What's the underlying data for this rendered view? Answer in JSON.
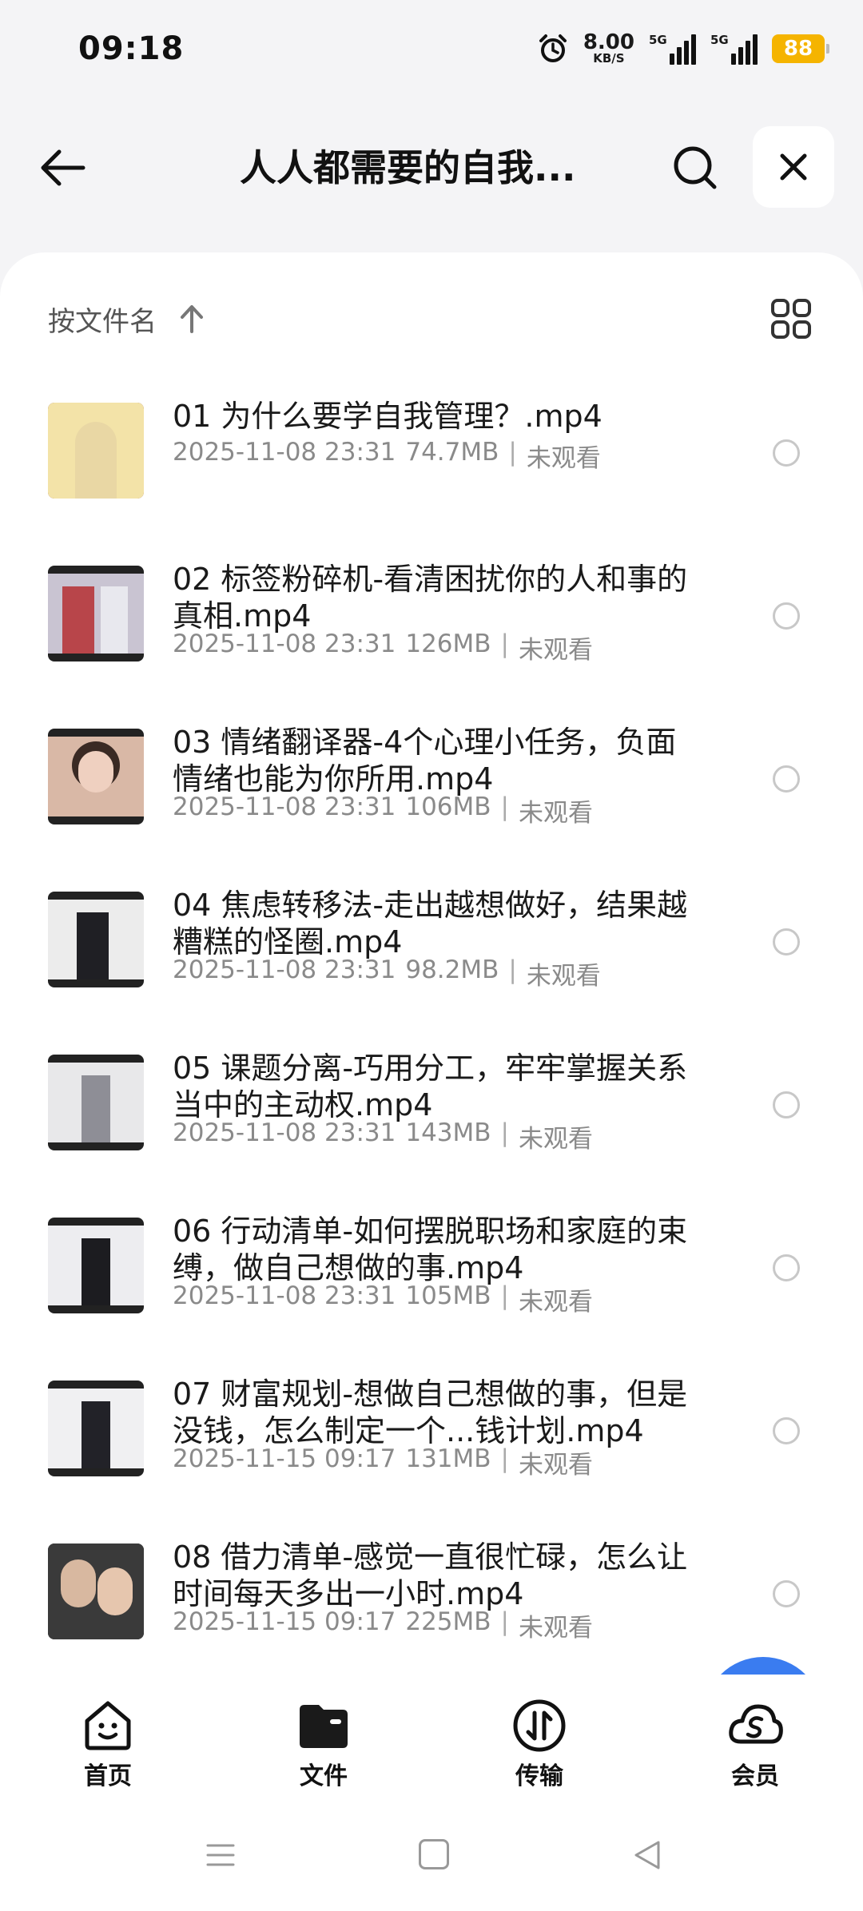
{
  "status_bar": {
    "time": "09:18",
    "net_speed_value": "8.00",
    "net_speed_unit": "KB/S",
    "signal1_tag": "5G",
    "signal2_tag": "5G",
    "battery": "88",
    "icons": [
      "alarm-icon",
      "signal-icon",
      "signal-icon",
      "battery-icon"
    ]
  },
  "header": {
    "title": "人人都需要的自我...",
    "icons": [
      "back-arrow-icon",
      "search-icon",
      "close-icon"
    ]
  },
  "sort": {
    "label": "按文件名",
    "direction": "ascending",
    "icons": [
      "arrow-up-icon",
      "grid-view-icon"
    ]
  },
  "files": [
    {
      "name": "01 为什么要学自我管理？.mp4",
      "date": "2025-11-08 23:31",
      "size": "74.7MB",
      "status": "未观看"
    },
    {
      "name": "02 标签粉碎机-看清困扰你的人和事的真相.mp4",
      "date": "2025-11-08 23:31",
      "size": "126MB",
      "status": "未观看"
    },
    {
      "name": "03 情绪翻译器-4个心理小任务，负面情绪也能为你所用.mp4",
      "date": "2025-11-08 23:31",
      "size": "106MB",
      "status": "未观看"
    },
    {
      "name": "04 焦虑转移法-走出越想做好，结果越糟糕的怪圈.mp4",
      "date": "2025-11-08 23:31",
      "size": "98.2MB",
      "status": "未观看"
    },
    {
      "name": "05 课题分离-巧用分工，牢牢掌握关系当中的主动权.mp4",
      "date": "2025-11-08 23:31",
      "size": "143MB",
      "status": "未观看"
    },
    {
      "name": "06 行动清单-如何摆脱职场和家庭的束缚，做自己想做的事.mp4",
      "date": "2025-11-08 23:31",
      "size": "105MB",
      "status": "未观看"
    },
    {
      "name": "07 财富规划-想做自己想做的事，但是没钱，怎么制定一个...钱计划.mp4",
      "date": "2025-11-15 09:17",
      "size": "131MB",
      "status": "未观看"
    },
    {
      "name": "08 借力清单-感觉一直很忙碌，怎么让时间每天多出一小时.mp4",
      "date": "2025-11-15 09:17",
      "size": "225MB",
      "status": "未观看"
    }
  ],
  "tabs": [
    {
      "label": "首页",
      "icon": "home-smile-icon"
    },
    {
      "label": "文件",
      "icon": "folder-icon"
    },
    {
      "label": "传输",
      "icon": "transfer-icon"
    },
    {
      "label": "会员",
      "icon": "vip-cloud-icon"
    }
  ],
  "colors": {
    "background": "#f4f4f6",
    "battery": "#f5b400",
    "fab": "#3a7cf0"
  }
}
